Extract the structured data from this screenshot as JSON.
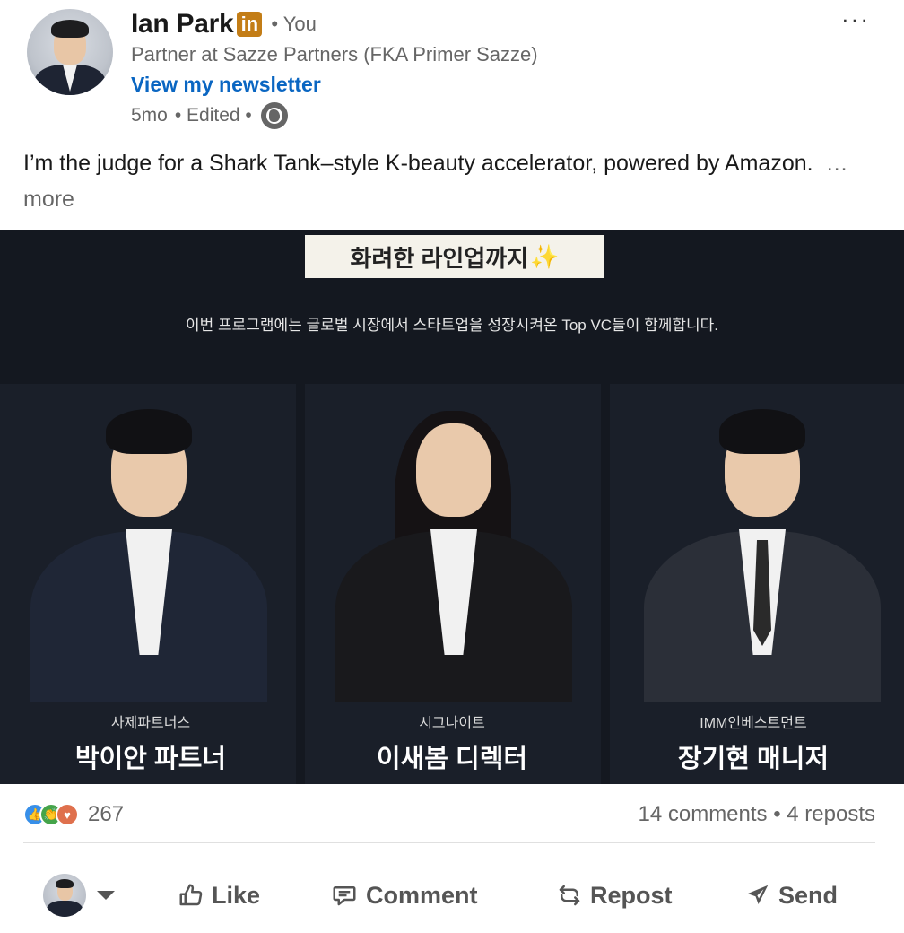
{
  "author": {
    "name": "Ian Park",
    "linkedin_badge": "in",
    "degree": "• You",
    "headline": "Partner at Sazze Partners (FKA Primer Sazze)",
    "newsletter_link": "View my newsletter",
    "time": "5mo",
    "edited": "• Edited •",
    "visibility_icon": "globe-icon"
  },
  "menu": {
    "more_label": "···"
  },
  "post": {
    "text": "I’m the judge for a Shark Tank–style K-beauty accelerator, powered by Amazon.",
    "see_more": "…more"
  },
  "image": {
    "title": "화려한 라인업까지",
    "title_icon": "✨",
    "subtitle": "이번 프로그램에는 글로벌 시장에서 스타트업을 성장시켜온 Top VC들이 함께합니다.",
    "people": [
      {
        "company": "사제파트너스",
        "role": "박이안 파트너"
      },
      {
        "company": "시그나이트",
        "role": "이새봄 디렉터"
      },
      {
        "company": "IMM인베스트먼트",
        "role": "장기현 매니저"
      }
    ]
  },
  "social": {
    "reaction_icons": [
      "like-icon",
      "celebrate-icon",
      "love-icon"
    ],
    "reaction_count": "267",
    "comments_reposts": "14 comments • 4 reposts"
  },
  "actions": {
    "like": "Like",
    "comment": "Comment",
    "repost": "Repost",
    "send": "Send"
  },
  "colors": {
    "link_blue": "#0a66c2",
    "linkedin_badge": "#c37d16",
    "panel_bg": "#141820"
  }
}
